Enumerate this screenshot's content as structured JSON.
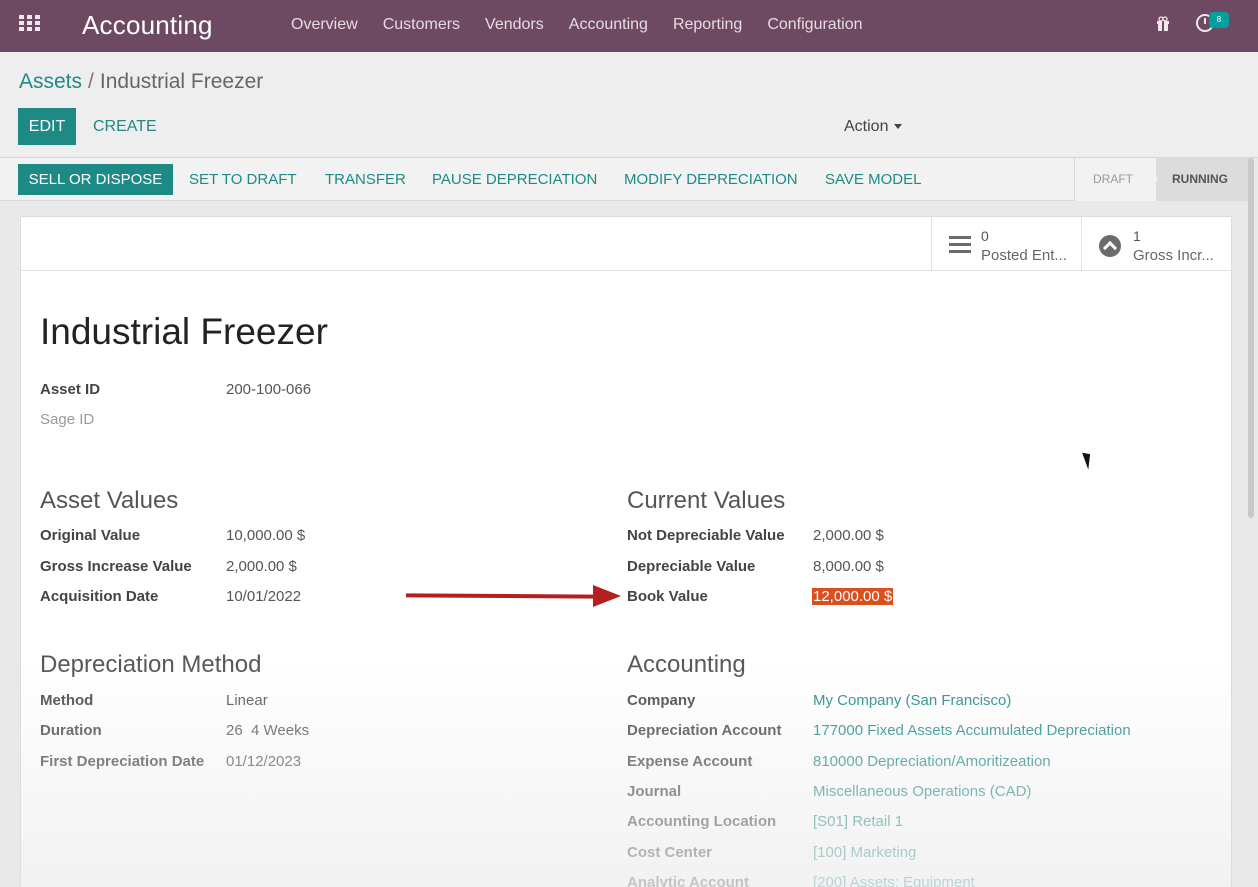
{
  "navbar": {
    "app_name": "Accounting",
    "menu": [
      "Overview",
      "Customers",
      "Vendors",
      "Accounting",
      "Reporting",
      "Configuration"
    ],
    "badge": "8"
  },
  "breadcrumb": {
    "parent": "Assets",
    "separator": "/",
    "current": "Industrial Freezer"
  },
  "control": {
    "edit_label": "EDIT",
    "create_label": "CREATE",
    "action_label": "Action"
  },
  "statusbar": {
    "buttons": [
      "SELL OR DISPOSE",
      "SET TO DRAFT",
      "TRANSFER",
      "PAUSE DEPRECIATION",
      "MODIFY DEPRECIATION",
      "SAVE MODEL"
    ],
    "stages": [
      "DRAFT",
      "RUNNING"
    ],
    "active_stage": "RUNNING"
  },
  "stat_buttons": [
    {
      "value": "0",
      "label": "Posted Ent..."
    },
    {
      "value": "1",
      "label": "Gross Incr..."
    }
  ],
  "record": {
    "title": "Industrial Freezer",
    "asset_id_label": "Asset ID",
    "asset_id": "200-100-066",
    "sage_id_label": "Sage ID"
  },
  "asset_values": {
    "heading": "Asset Values",
    "rows": [
      {
        "label": "Original Value",
        "value": "10,000.00 $"
      },
      {
        "label": "Gross Increase Value",
        "value": "2,000.00 $"
      },
      {
        "label": "Acquisition Date",
        "value": "10/01/2022"
      }
    ]
  },
  "current_values": {
    "heading": "Current Values",
    "rows": [
      {
        "label": "Not Depreciable Value",
        "value": "2,000.00 $"
      },
      {
        "label": "Depreciable Value",
        "value": "8,000.00 $"
      },
      {
        "label": "Book Value",
        "value": "12,000.00 $"
      }
    ]
  },
  "depreciation": {
    "heading": "Depreciation Method",
    "rows": [
      {
        "label": "Method",
        "value": "Linear"
      },
      {
        "label": "Duration",
        "value": "26  4 Weeks"
      },
      {
        "label": "First Depreciation Date",
        "value": "01/12/2023"
      }
    ]
  },
  "accounting": {
    "heading": "Accounting",
    "rows": [
      {
        "label": "Company",
        "value": "My Company (San Francisco)"
      },
      {
        "label": "Depreciation Account",
        "value": "177000 Fixed Assets Accumulated Depreciation"
      },
      {
        "label": "Expense Account",
        "value": "810000 Depreciation/Amoritizeation"
      },
      {
        "label": "Journal",
        "value": "Miscellaneous Operations (CAD)"
      },
      {
        "label": "Accounting Location",
        "value": "[S01] Retail 1"
      },
      {
        "label": "Cost Center",
        "value": "[100] Marketing"
      },
      {
        "label": "Analytic Account",
        "value": "[200] Assets: Equipment"
      }
    ]
  },
  "colors": {
    "navbar": "#6e4a62",
    "primary": "#1e8a86",
    "highlight": "#d94f1e",
    "annotation_arrow": "#b41e1e"
  }
}
